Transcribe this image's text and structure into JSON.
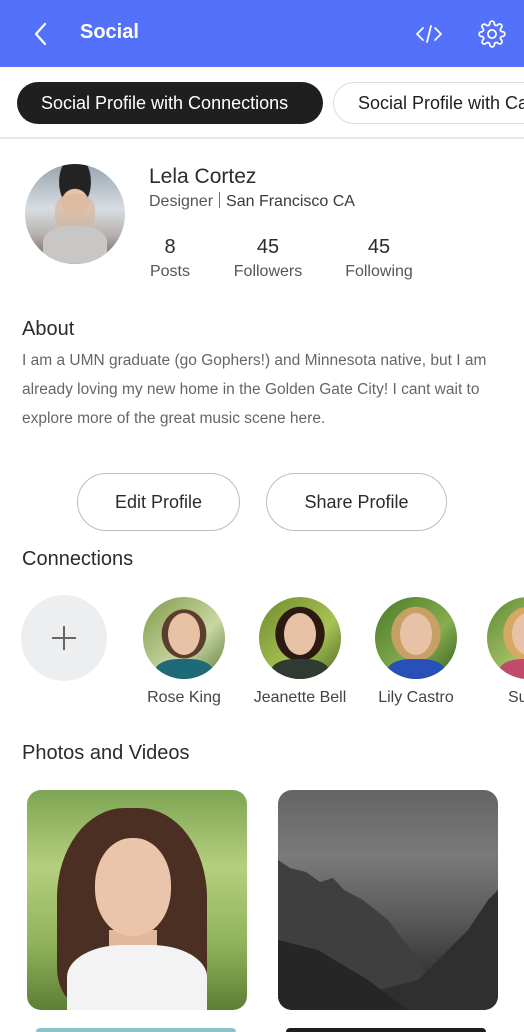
{
  "appbar": {
    "title": "Social",
    "back_icon": "chevron-left-icon",
    "actions": [
      {
        "icon": "code-icon"
      },
      {
        "icon": "gear-icon"
      }
    ],
    "color": "#5471fb"
  },
  "tabs": [
    {
      "label": "Social Profile with Connections",
      "active": true
    },
    {
      "label": "Social Profile with Ca",
      "active": false
    }
  ],
  "profile": {
    "name": "Lela Cortez",
    "role": "Designer",
    "location": "San Francisco CA",
    "stats": [
      {
        "value": "8",
        "label": "Posts"
      },
      {
        "value": "45",
        "label": "Followers"
      },
      {
        "value": "45",
        "label": "Following"
      }
    ]
  },
  "about": {
    "title": "About",
    "text": "I am a UMN graduate (go Gophers!) and Minnesota native, but I am already loving my new home in the Golden Gate City! I cant wait to explore more of the great music scene here."
  },
  "actions": {
    "edit_label": "Edit Profile",
    "share_label": "Share Profile"
  },
  "connections": {
    "title": "Connections",
    "add_icon": "plus-icon",
    "people": [
      {
        "name": "Rose King"
      },
      {
        "name": "Jeanette Bell"
      },
      {
        "name": "Lily Castro"
      },
      {
        "name": "Susie"
      }
    ]
  },
  "photos": {
    "title": "Photos and Videos"
  }
}
